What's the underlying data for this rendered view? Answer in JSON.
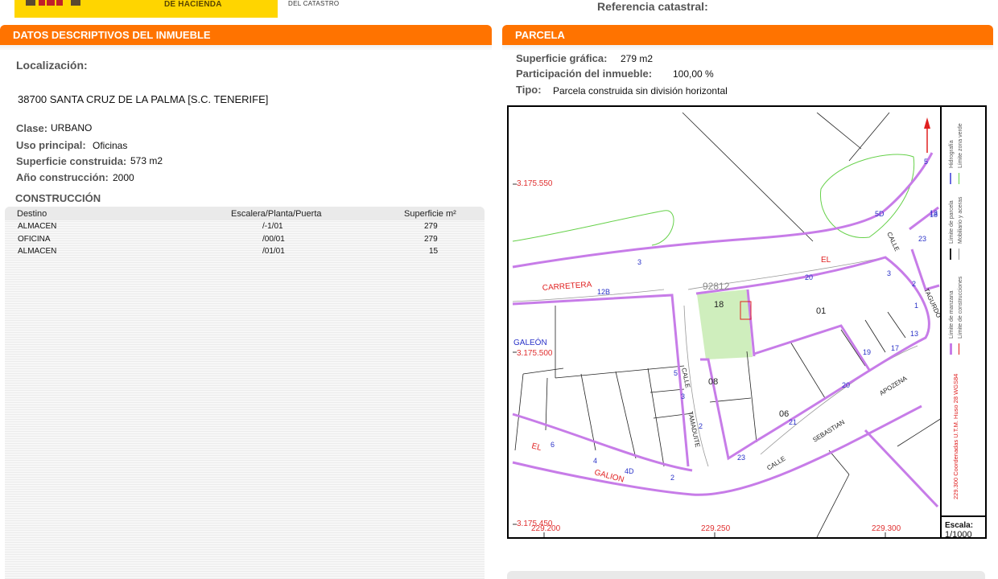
{
  "header": {
    "ministry_line": "DE HACIENDA",
    "office_line": "DEL CATASTRO",
    "reference_label": "Referencia catastral:"
  },
  "left": {
    "section_title": "DATOS DESCRIPTIVOS DEL INMUEBLE",
    "location_label": "Localización:",
    "address": "38700 SANTA CRUZ DE LA PALMA [S.C. TENERIFE]",
    "clase_label": "Clase:",
    "clase_value": "URBANO",
    "uso_label": "Uso principal:",
    "uso_value": "Oficinas",
    "superficie_label": "Superficie construida:",
    "superficie_value": "573 m2",
    "anio_label": "Año construcción:",
    "anio_value": "2000",
    "construccion_title": "CONSTRUCCIÓN",
    "table": {
      "headers": [
        "Destino",
        "Escalera/Planta/Puerta",
        "Superficie m²"
      ],
      "rows": [
        [
          "ALMACEN",
          "/-1/01",
          "279"
        ],
        [
          "OFICINA",
          "/00/01",
          "279"
        ],
        [
          "ALMACEN",
          "/01/01",
          "15"
        ]
      ]
    }
  },
  "right": {
    "section_title": "PARCELA",
    "sup_grafica_label": "Superficie gráfica:",
    "sup_grafica_value": "279 m2",
    "participacion_label": "Participación del inmueble:",
    "participacion_value": "100,00 %",
    "tipo_label": "Tipo:",
    "tipo_value": "Parcela construida sin división horizontal"
  },
  "map": {
    "y_coords": [
      "3.175.550",
      "3.175.500",
      "3.175.450"
    ],
    "x_coords": [
      "229.200",
      "229.250",
      "229.300"
    ],
    "street_labels": [
      "CARRETERA",
      "EL",
      "GALEÓN",
      "EL",
      "GALION",
      "CALLE",
      "TAMADUITE",
      "CALLE",
      "SEBASTIAN",
      "APOZENA",
      "CALLE",
      "TAGURDO"
    ],
    "parcel_numbers": [
      "18",
      "01",
      "08",
      "06",
      "92812"
    ],
    "house_numbers": [
      "5",
      "5D",
      "3",
      "12B",
      "20",
      "3",
      "2",
      "1",
      "13",
      "23",
      "19",
      "17",
      "18",
      "20",
      "21",
      "23",
      "5",
      "3",
      "2",
      "6",
      "4",
      "4D",
      "2",
      "13"
    ],
    "legend": {
      "coords_text": "229.300 Coordenadas U.T.M. Huso 28 WGS84",
      "items": [
        "Límite de manzana",
        "Límite de construcciones",
        "Límite de parcela",
        "Mobiliario y aceras",
        "Hidrografía",
        "Límite zona verde"
      ]
    },
    "scale_label": "Escala:",
    "scale_value": "1/1000",
    "colors": {
      "parcel_line": "#c77ce8",
      "street_text": "#e02020",
      "number_text": "#2a32c8",
      "green_zone": "#cfeebd",
      "green_line": "#66d14a",
      "coord_text": "#e03030"
    }
  }
}
